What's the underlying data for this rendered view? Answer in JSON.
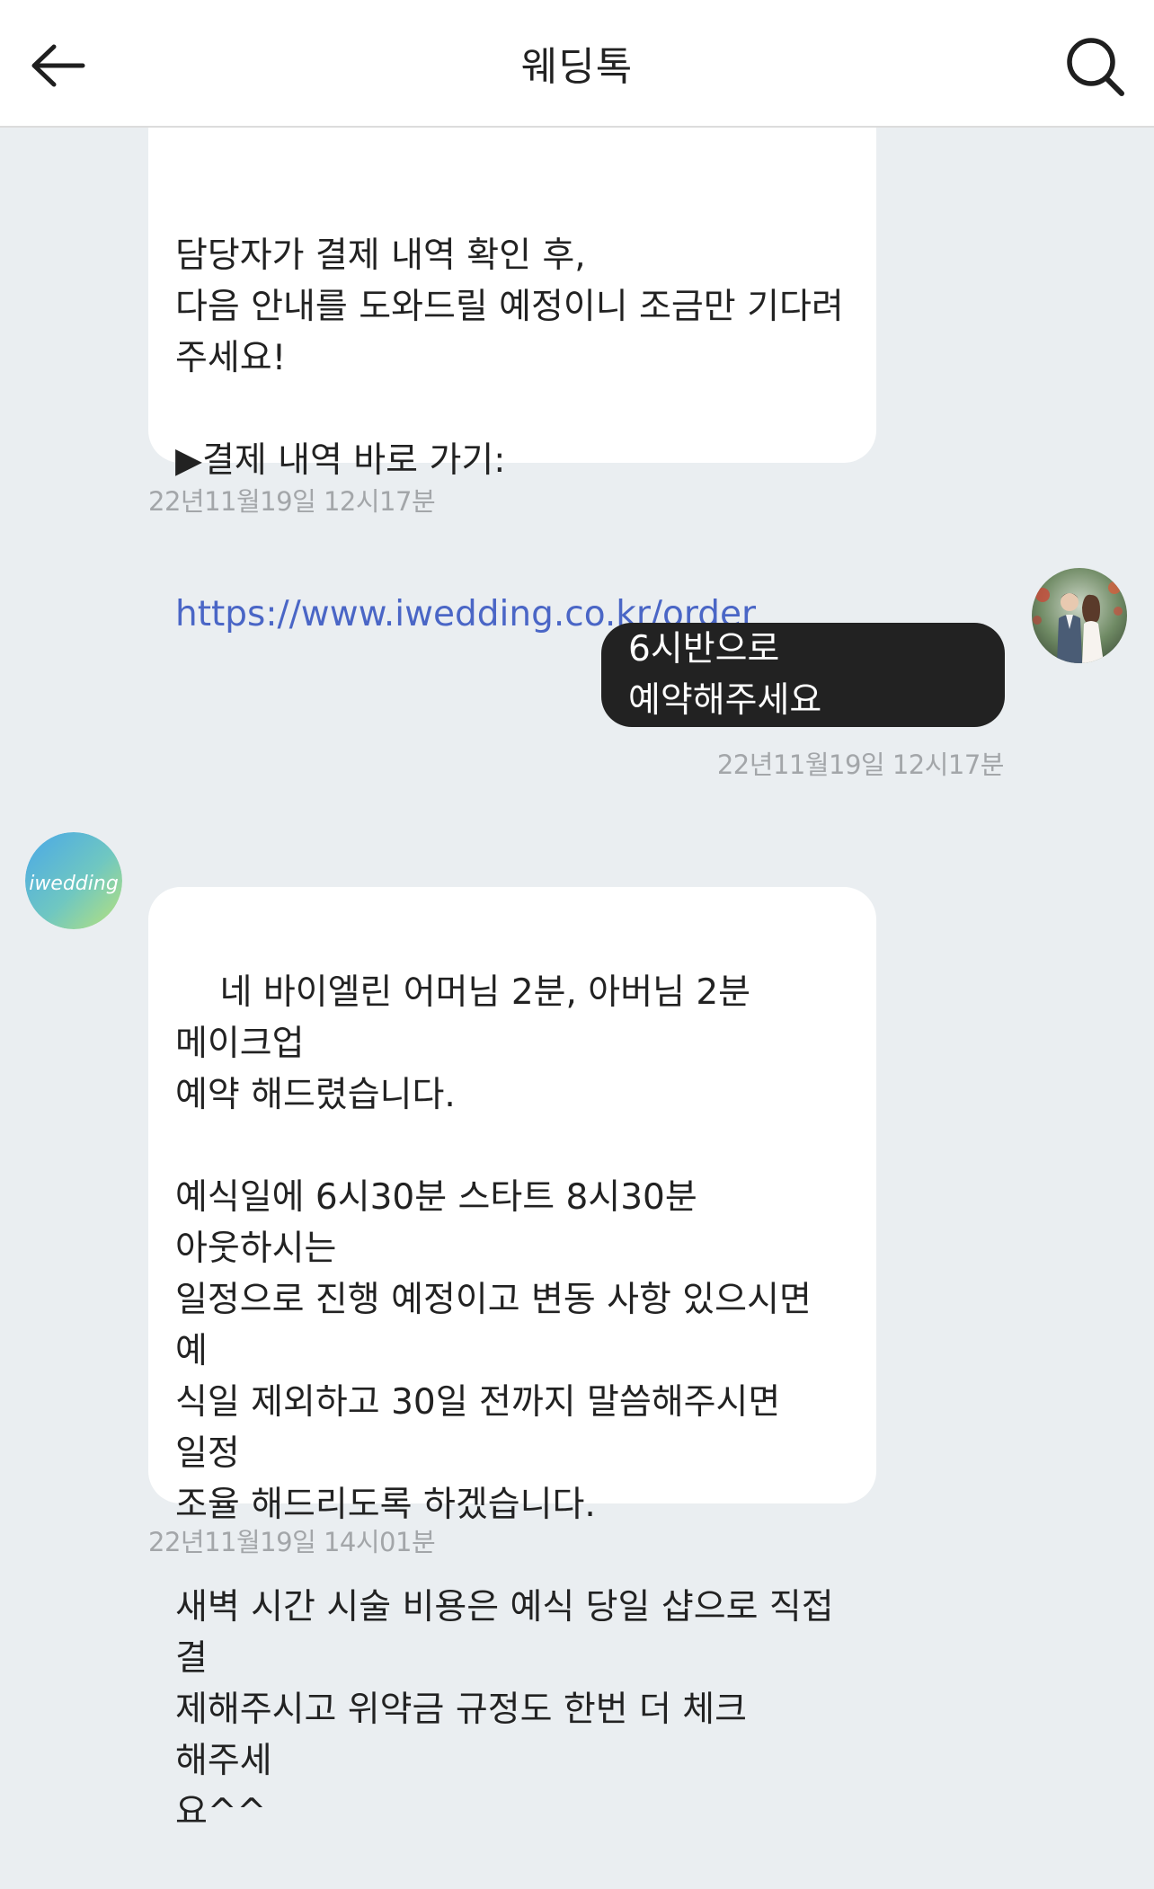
{
  "header": {
    "title": "웨딩톡",
    "back_icon": "arrow-left-icon",
    "search_icon": "search-icon"
  },
  "messages": [
    {
      "sender": "bot",
      "text": "담당자가 결제 내역 확인 후,\n다음 안내를 도와드릴 예정이니 조금만 기다려\n주세요!\n\n▶결제 내역 바로 가기:",
      "link": "https://www.iwedding.co.kr/order",
      "time": "22년11월19일 12시17분"
    },
    {
      "sender": "user",
      "text": "6시반으로 예약해주세요",
      "time": "22년11월19일 12시17분"
    },
    {
      "sender": "bot",
      "text": "네 바이엘린 어머님 2분, 아버님 2분 메이크업\n예약 해드렸습니다.\n\n예식일에 6시30분 스타트 8시30분 아웃하시는\n일정으로 진행 예정이고 변동 사항 있으시면 예\n식일 제외하고 30일 전까지 말씀해주시면 일정\n조율 해드리도록 하겠습니다.\n\n새벽 시간 시술 비용은 예식 당일 샵으로 직접 결\n제해주시고 위약금 규정도 한번 더 체크 해주세\n요^^",
      "time": "22년11월19일 14시01분"
    }
  ],
  "avatars": {
    "user": "couple-photo-avatar",
    "brand": "iwedding-logo-avatar",
    "brand_logo_text": "iwedding"
  },
  "colors": {
    "background": "#eaeef1",
    "incoming_bubble": "#ffffff",
    "outgoing_bubble": "#222222",
    "link": "#4a66c6",
    "timestamp": "#a3a6a9"
  }
}
